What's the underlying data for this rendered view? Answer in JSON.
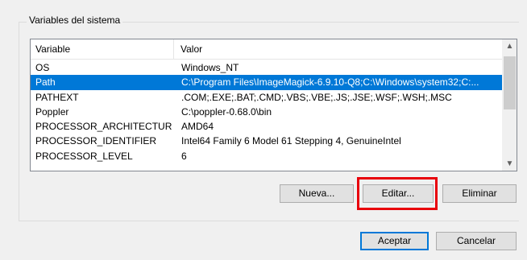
{
  "group": {
    "label": "Variables del sistema"
  },
  "list": {
    "columns": [
      "Variable",
      "Valor"
    ],
    "rows": [
      {
        "variable": "OS",
        "value": "Windows_NT",
        "selected": false
      },
      {
        "variable": "Path",
        "value": "C:\\Program Files\\ImageMagick-6.9.10-Q8;C:\\Windows\\system32;C:...",
        "selected": true
      },
      {
        "variable": "PATHEXT",
        "value": ".COM;.EXE;.BAT;.CMD;.VBS;.VBE;.JS;.JSE;.WSF;.WSH;.MSC",
        "selected": false
      },
      {
        "variable": "Poppler",
        "value": "C:\\poppler-0.68.0\\bin",
        "selected": false
      },
      {
        "variable": "PROCESSOR_ARCHITECTURE",
        "value": "AMD64",
        "selected": false
      },
      {
        "variable": "PROCESSOR_IDENTIFIER",
        "value": "Intel64 Family 6 Model 61 Stepping 4, GenuineIntel",
        "selected": false
      },
      {
        "variable": "PROCESSOR_LEVEL",
        "value": "6",
        "selected": false
      }
    ],
    "selection_color": "#0078d7"
  },
  "buttons": {
    "new": "Nueva...",
    "edit": "Editar...",
    "delete": "Eliminar",
    "accept": "Aceptar",
    "cancel": "Cancelar"
  },
  "icons": {
    "scroll_up": "chevron-up-icon",
    "scroll_down": "chevron-down-icon"
  },
  "annotation_color": "#e8000b"
}
